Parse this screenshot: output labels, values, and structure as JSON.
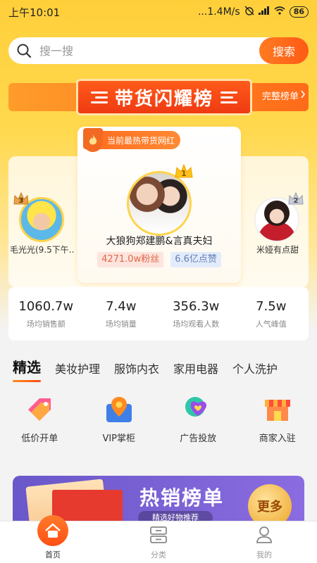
{
  "status_bar": {
    "time": "上午10:01",
    "network_speed": "...1.4M/s",
    "battery": "86",
    "icons": [
      "alarm-off-icon",
      "signal-icon",
      "wifi-icon",
      "battery-icon"
    ]
  },
  "search": {
    "placeholder": "搜一搜",
    "button_label": "搜索",
    "icon": "search-icon"
  },
  "banner": {
    "title": "带货闪耀榜",
    "full_list_label": "完整榜单",
    "full_list_icon": "chevron-right-icon"
  },
  "ranking": {
    "hot_tag": "当前最热带货网红",
    "hot_tag_icon": "flame-icon",
    "first": {
      "rank": "1",
      "name": "大狼狗郑建鹏&言真夫妇",
      "fans": "4271.0w粉丝",
      "likes": "6.6亿点赞"
    },
    "second": {
      "rank": "2",
      "name": "米娅有点甜"
    },
    "third": {
      "rank": "3",
      "name": "毛光光(9.5下午..."
    },
    "stats": [
      {
        "value": "1060.7w",
        "label": "场均销售额"
      },
      {
        "value": "7.4w",
        "label": "场均销量"
      },
      {
        "value": "356.3w",
        "label": "场均观看人数"
      },
      {
        "value": "7.5w",
        "label": "人气峰值"
      }
    ]
  },
  "tabs": [
    {
      "label": "精选",
      "active": true
    },
    {
      "label": "美妆护理",
      "active": false
    },
    {
      "label": "服饰内衣",
      "active": false
    },
    {
      "label": "家用电器",
      "active": false
    },
    {
      "label": "个人洗护",
      "active": false
    }
  ],
  "features": [
    {
      "label": "低价开单",
      "icon": "price-tag-icon"
    },
    {
      "label": "VIP掌柜",
      "icon": "location-pin-icon"
    },
    {
      "label": "广告投放",
      "icon": "heart-chat-icon"
    },
    {
      "label": "商家入驻",
      "icon": "store-icon"
    }
  ],
  "hot_banner": {
    "title": "热销榜单",
    "subtitle": "精选好物推荐",
    "more_label": "更多"
  },
  "bottom_nav": [
    {
      "label": "首页",
      "icon": "home-icon",
      "active": true
    },
    {
      "label": "分类",
      "icon": "category-icon",
      "active": false
    },
    {
      "label": "我的",
      "icon": "profile-icon",
      "active": false
    }
  ],
  "colors": {
    "accent": "#ff5a14",
    "header_yellow": "#ffd23f",
    "fans_text": "#e2674a",
    "likes_text": "#6680b8"
  }
}
